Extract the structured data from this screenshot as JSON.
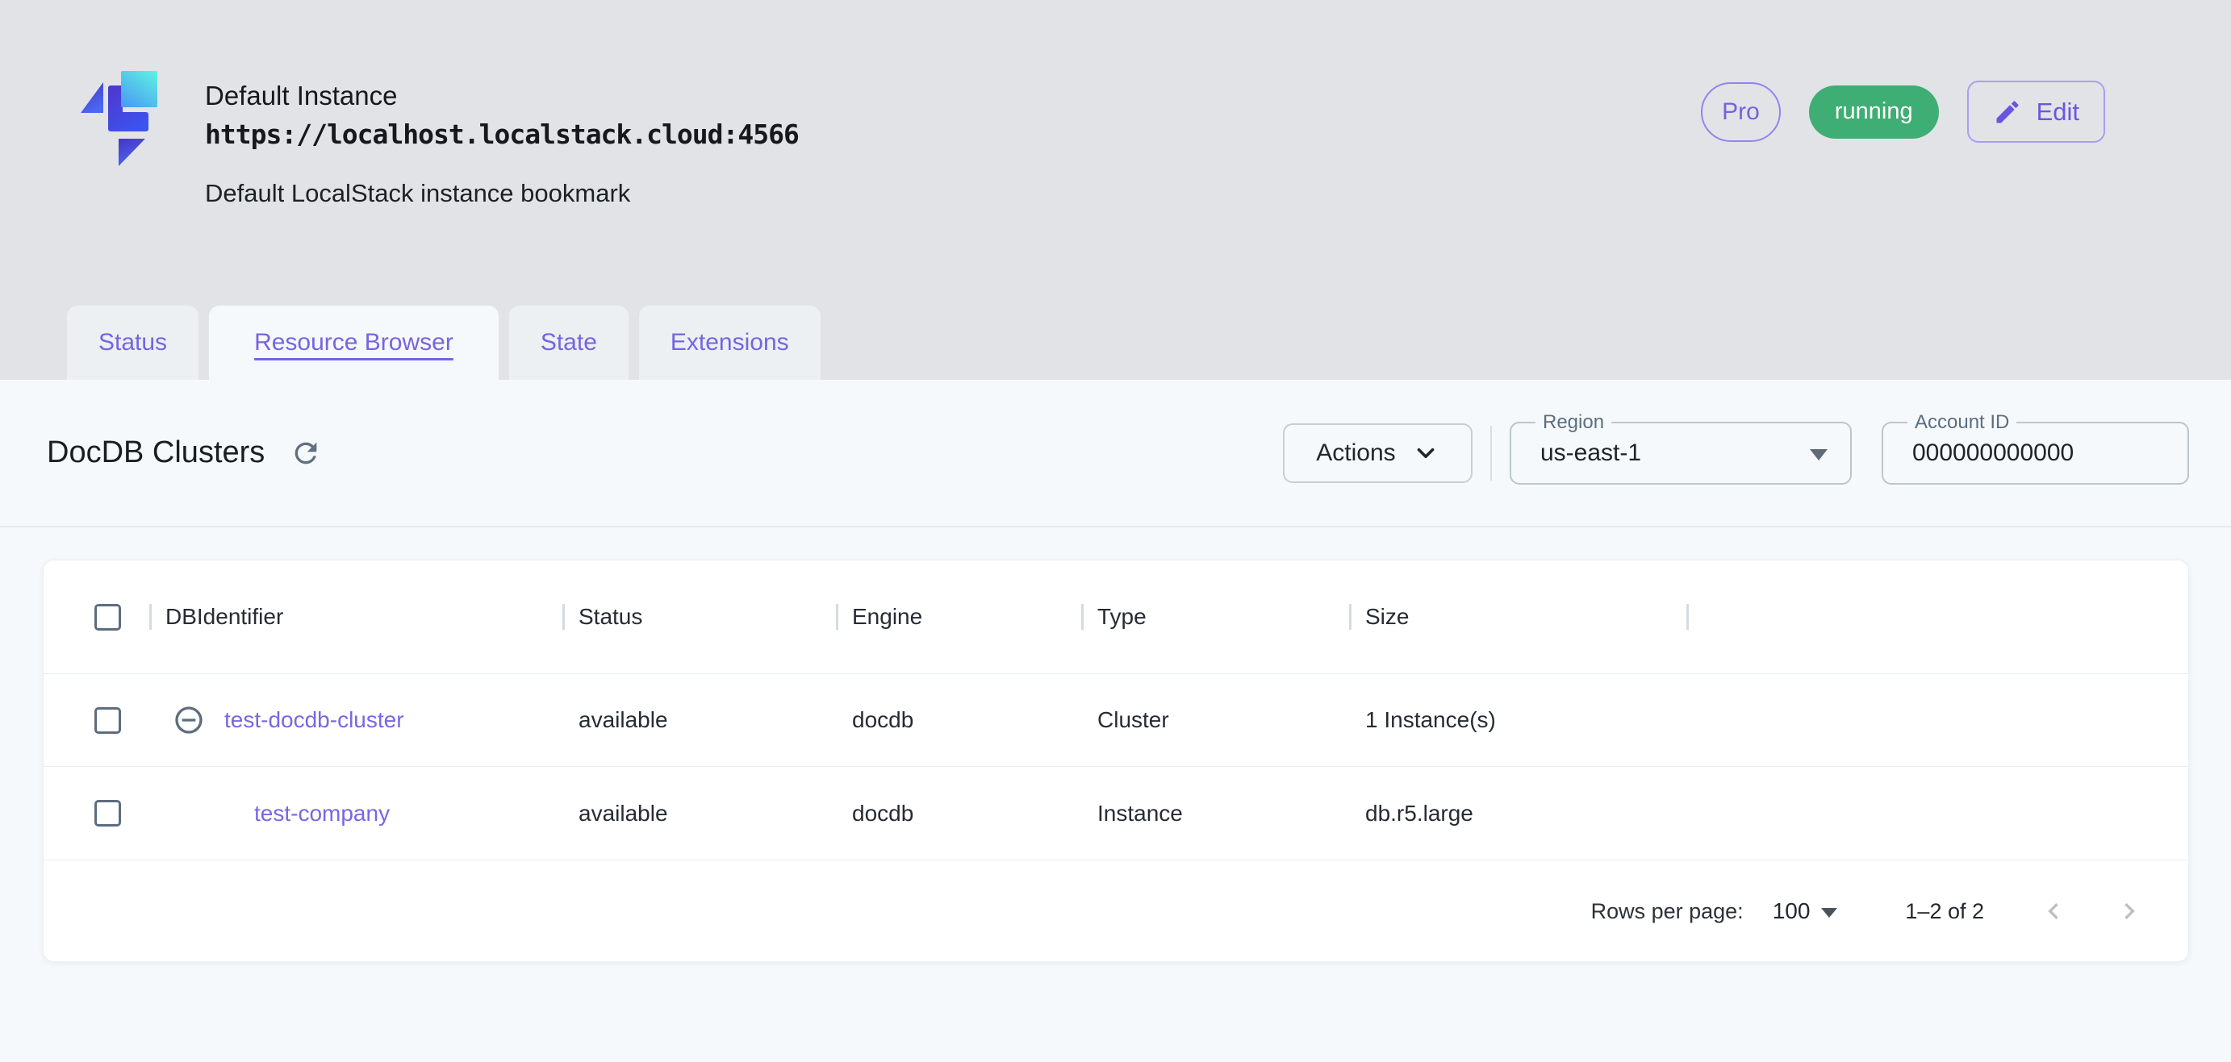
{
  "header": {
    "title": "Default Instance",
    "url": "https://localhost.localstack.cloud:4566",
    "subtitle": "Default LocalStack instance bookmark",
    "pro_badge": "Pro",
    "status_badge": "running",
    "edit_button": "Edit"
  },
  "tabs": [
    {
      "label": "Status"
    },
    {
      "label": "Resource Browser"
    },
    {
      "label": "State"
    },
    {
      "label": "Extensions"
    }
  ],
  "toolbar": {
    "page_title": "DocDB Clusters",
    "actions_button": "Actions",
    "region": {
      "label": "Region",
      "value": "us-east-1"
    },
    "account": {
      "label": "Account ID",
      "value": "000000000000"
    }
  },
  "table": {
    "columns": {
      "id": "DBIdentifier",
      "status": "Status",
      "engine": "Engine",
      "type": "Type",
      "size": "Size"
    },
    "rows": [
      {
        "id": "test-docdb-cluster",
        "status": "available",
        "engine": "docdb",
        "type": "Cluster",
        "size": "1 Instance(s)"
      },
      {
        "id": "test-company",
        "status": "available",
        "engine": "docdb",
        "type": "Instance",
        "size": "db.r5.large"
      }
    ],
    "pagination": {
      "rows_per_page_label": "Rows per page:",
      "rows_per_page_value": "100",
      "range": "1–2 of 2"
    }
  },
  "colors": {
    "primary_purple": "#7565e0",
    "success_green": "#3fae74",
    "header_gray": "#e1e3e7",
    "content_bg": "#f6f9fb",
    "slate_icon": "#5d6d7e"
  }
}
